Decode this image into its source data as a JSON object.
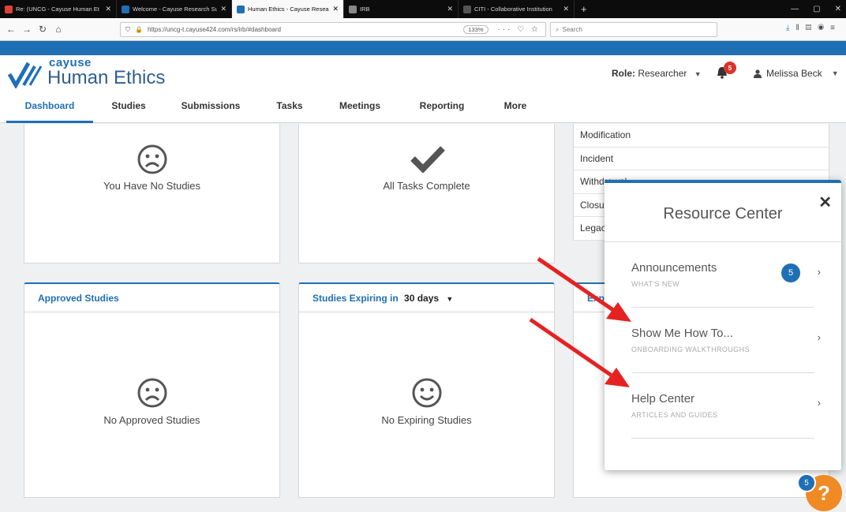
{
  "browser": {
    "tabs": [
      {
        "title": "Re: (UNCG - Cayuse Human Et",
        "active": false,
        "color": "#db4437"
      },
      {
        "title": "Welcome - Cayuse Research Su",
        "active": false,
        "color": "#1f6fb5"
      },
      {
        "title": "Human Ethics - Cayuse Resear",
        "active": true,
        "color": "#1f6fb5"
      },
      {
        "title": "IRB",
        "active": false,
        "color": "#888888"
      },
      {
        "title": "CITI - Collaborative Institution",
        "active": false,
        "color": "#555555"
      }
    ],
    "url": "https://uncg-t.cayuse424.com/rs/irb/#dashboard",
    "zoom": "133%",
    "search_placeholder": "Search"
  },
  "app": {
    "brand_top": "cayuse",
    "brand_main": "Human Ethics",
    "role_label": "Role:",
    "role_value": "Researcher",
    "notification_count": "5",
    "user_name": "Melissa Beck"
  },
  "nav": [
    {
      "label": "Dashboard",
      "active": true
    },
    {
      "label": "Studies"
    },
    {
      "label": "Submissions"
    },
    {
      "label": "Tasks"
    },
    {
      "label": "Meetings"
    },
    {
      "label": "Reporting"
    },
    {
      "label": "More"
    }
  ],
  "cards": {
    "studies_empty": "You Have No Studies",
    "tasks_empty": "All Tasks Complete",
    "approved_title": "Approved Studies",
    "approved_empty": "No Approved Studies",
    "expiring_title": "Studies Expiring in",
    "expiring_value": "30 days",
    "expiring_empty": "No Expiring Studies",
    "third_title_partial": "Exp"
  },
  "submission_types": [
    "Modification",
    "Incident",
    "Withdrawal",
    "Closure",
    "Legacy"
  ],
  "resource_center": {
    "title": "Resource Center",
    "items": [
      {
        "title": "Announcements",
        "subtitle": "WHAT'S NEW",
        "badge": "5"
      },
      {
        "title": "Show Me How To...",
        "subtitle": "ONBOARDING WALKTHROUGHS"
      },
      {
        "title": "Help Center",
        "subtitle": "ARTICLES AND GUIDES"
      }
    ]
  },
  "help": {
    "badge": "5",
    "label": "?"
  },
  "colors": {
    "brand_blue": "#1f6fb5",
    "arrow_red": "#e52222",
    "help_orange": "#f08a24"
  }
}
